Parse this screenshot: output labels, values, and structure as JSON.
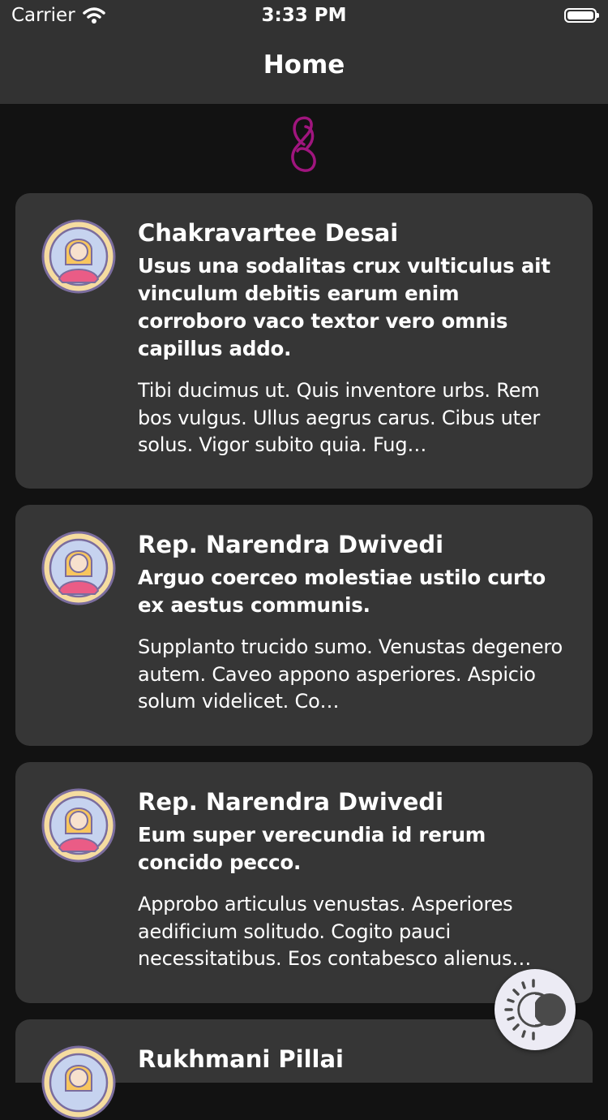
{
  "status_bar": {
    "carrier": "Carrier",
    "time": "3:33 PM"
  },
  "nav": {
    "title": "Home"
  },
  "colors": {
    "brand": "#a0157e",
    "card_bg": "#363636",
    "page_bg": "#121212",
    "bar_bg": "#323232"
  },
  "posts": [
    {
      "author": "Chakravartee Desai",
      "subject": "Usus una sodalitas crux vulticulus ait vinculum debitis earum enim corroboro vaco textor vero omnis capillus addo.",
      "body": "Tibi ducimus ut. Quis inventore urbs. Rem bos vulgus. Ullus aegrus carus. Cibus uter solus. Vigor subito quia. Fug…"
    },
    {
      "author": "Rep. Narendra Dwivedi",
      "subject": "Arguo coerceo molestiae ustilo curto ex aestus communis.",
      "body": "Supplanto trucido sumo. Venustas degenero autem. Caveo appono asperiores. Aspicio solum videlicet. Co…"
    },
    {
      "author": "Rep. Narendra Dwivedi",
      "subject": "Eum super verecundia id rerum concido pecco.",
      "body": "Approbo articulus venustas. Asperiores aedificium solitudo. Cogito pauci necessitatibus. Eos contabesco alienus…"
    },
    {
      "author": "Rukhmani Pillai",
      "subject": "",
      "body": ""
    }
  ],
  "fab": {
    "icon": "theme-toggle-icon"
  }
}
